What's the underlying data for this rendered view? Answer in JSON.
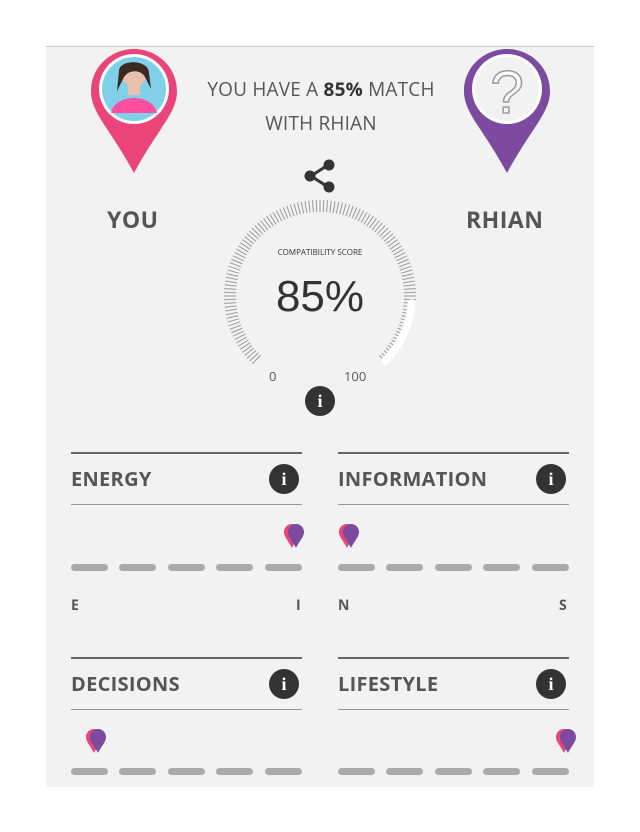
{
  "match": {
    "prefix": "YOU HAVE A ",
    "percent": "85%",
    "suffix": " MATCH",
    "line2": "WITH RHIAN"
  },
  "you": {
    "name": "YOU",
    "pin_color": "#e9457a"
  },
  "other": {
    "name": "RHIAN",
    "pin_color": "#7c4a9e",
    "placeholder": "?"
  },
  "gauge": {
    "label": "COMPATIBILITY SCORE",
    "value": "85%",
    "score": 85,
    "min_label": "0",
    "max_label": "100"
  },
  "sections": [
    {
      "title": "ENERGY",
      "left": "E",
      "right": "I",
      "position": 1.0
    },
    {
      "title": "INFORMATION",
      "left": "N",
      "right": "S",
      "position": 0.0
    },
    {
      "title": "DECISIONS",
      "left": "",
      "right": "",
      "position": 0.1
    },
    {
      "title": "LIFESTYLE",
      "left": "",
      "right": "",
      "position": 1.0
    }
  ],
  "info_glyph": "i",
  "colors": {
    "you": "#e9457a",
    "other": "#7c4a9e",
    "card": "#f2f2f2"
  }
}
